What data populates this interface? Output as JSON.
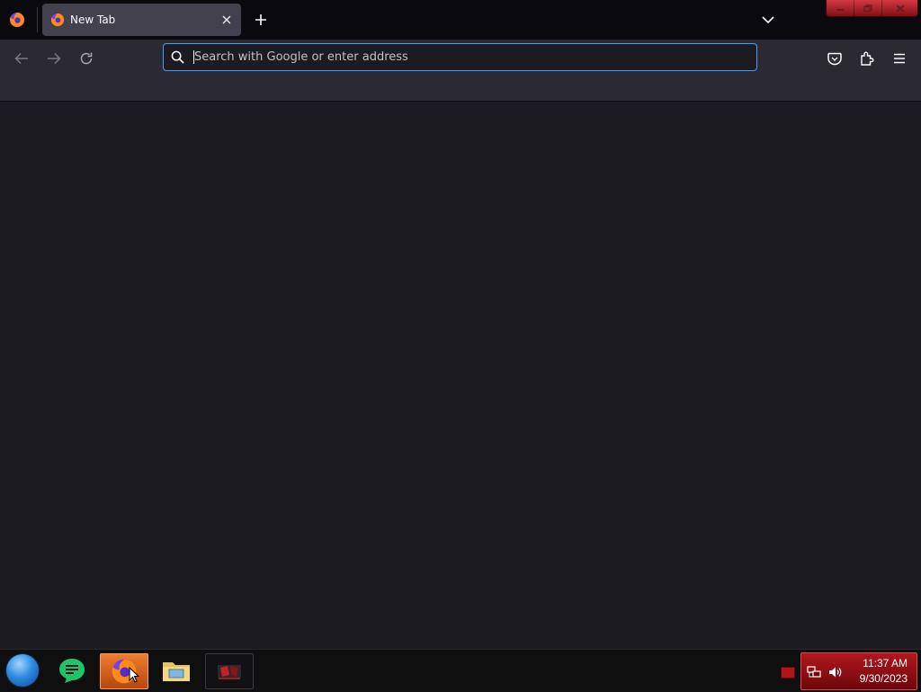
{
  "browser": {
    "tabs": [
      {
        "title": "New Tab",
        "favicon": "firefox-icon",
        "active": true
      }
    ],
    "urlbar": {
      "placeholder": "Search with Google or enter address",
      "value": ""
    },
    "accent_color": "#45a1ff"
  },
  "taskbar": {
    "apps": [
      "start-orb",
      "chat-icon",
      "firefox-icon",
      "file-explorer-icon",
      "game-app-icon"
    ],
    "active_app": "firefox-icon",
    "clock": {
      "time": "11:37 AM",
      "date": "9/30/2023"
    },
    "tray_color": "#b1171d"
  }
}
